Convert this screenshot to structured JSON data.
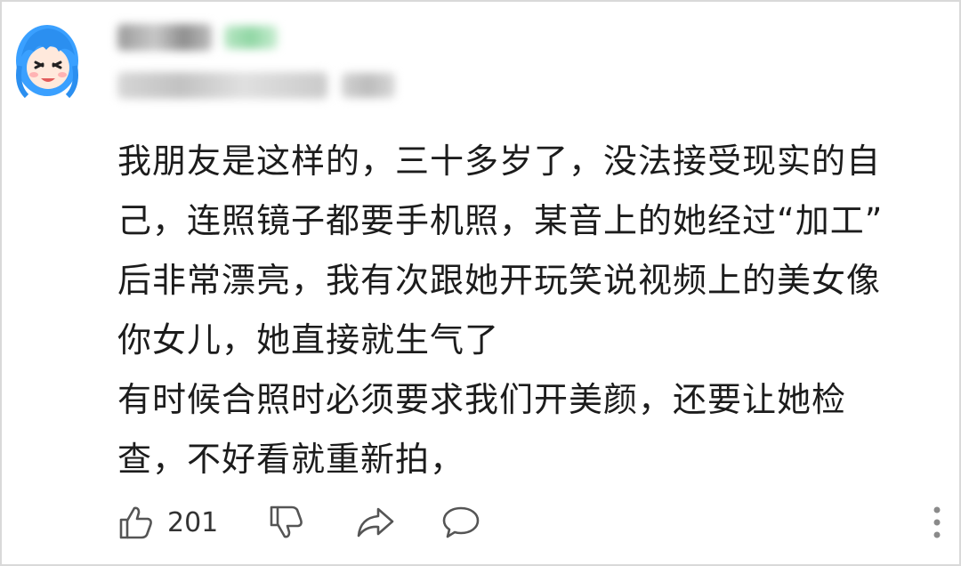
{
  "comment": {
    "lines": [
      "我朋友是这样的，三十多岁了，没法接受现实的自",
      "己，连照镜子都要手机照，某音上的她经过“加工”",
      "后非常漂亮，我有次跟她开玩笑说视频上的美女像",
      "你女儿，她直接就生气了",
      "有时候合照时必须要求我们开美颜，还要让她检",
      "查，不好看就重新拍，"
    ]
  },
  "actions": {
    "like_count": "201",
    "icons": [
      "thumbs-up-icon",
      "thumbs-down-icon",
      "share-icon",
      "comment-icon",
      "more-vertical-icon"
    ]
  },
  "colors": {
    "text": "#1c1c1c",
    "icon": "#555555",
    "avatar_hair": "#3aa0ff",
    "border": "#d9d9d9"
  }
}
